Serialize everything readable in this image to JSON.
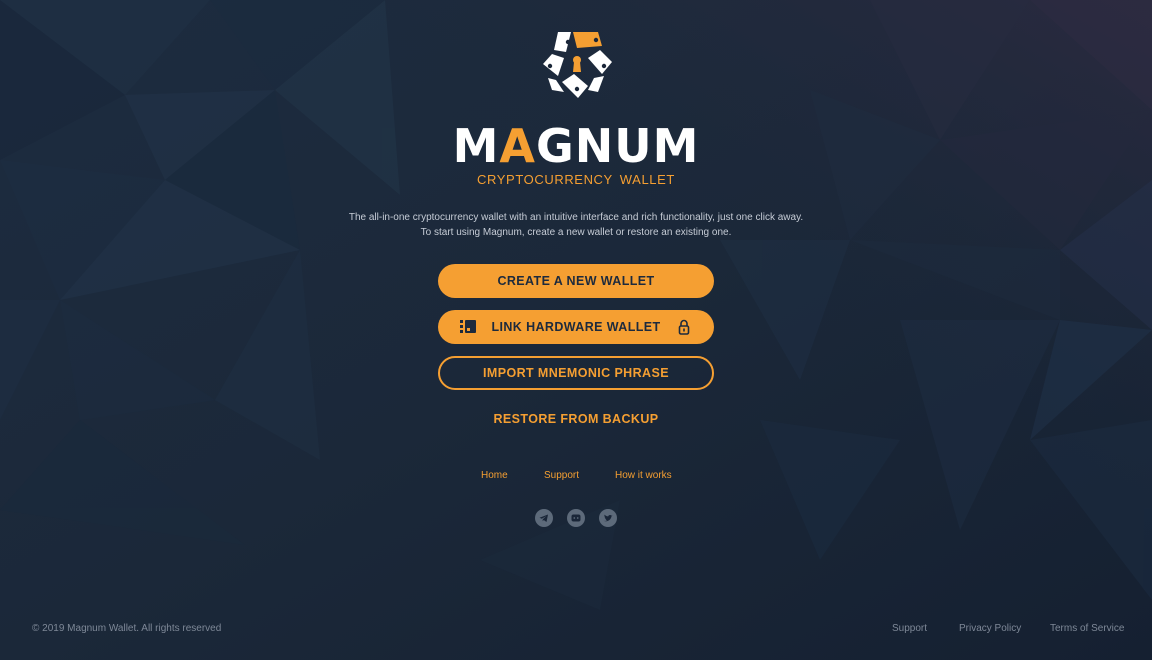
{
  "brand": {
    "title_part1": "M",
    "title_accent": "A",
    "title_part2": "GNUM",
    "subtitle": "CRYPTOCURRENCY  WALLET"
  },
  "description": {
    "line1": "The all-in-one cryptocurrency wallet with an intuitive interface and rich functionality, just one click away.",
    "line2": "To start using Magnum, create a new wallet or restore an existing one."
  },
  "actions": {
    "create_label": "CREATE A NEW WALLET",
    "link_hardware_label": "LINK HARDWARE WALLET",
    "import_label": "IMPORT MNEMONIC PHRASE",
    "restore_label": "RESTORE FROM BACKUP"
  },
  "nav": {
    "home": "Home",
    "support": "Support",
    "how_it_works": "How it works"
  },
  "social": [
    "telegram-icon",
    "discord-icon",
    "twitter-icon"
  ],
  "footer": {
    "copyright": "© 2019 Magnum Wallet. All rights reserved",
    "support": "Support",
    "privacy": "Privacy Policy",
    "terms": "Terms of Service"
  },
  "colors": {
    "accent": "#f59f32",
    "background": "#1a2638",
    "text_muted": "#7e8897"
  }
}
